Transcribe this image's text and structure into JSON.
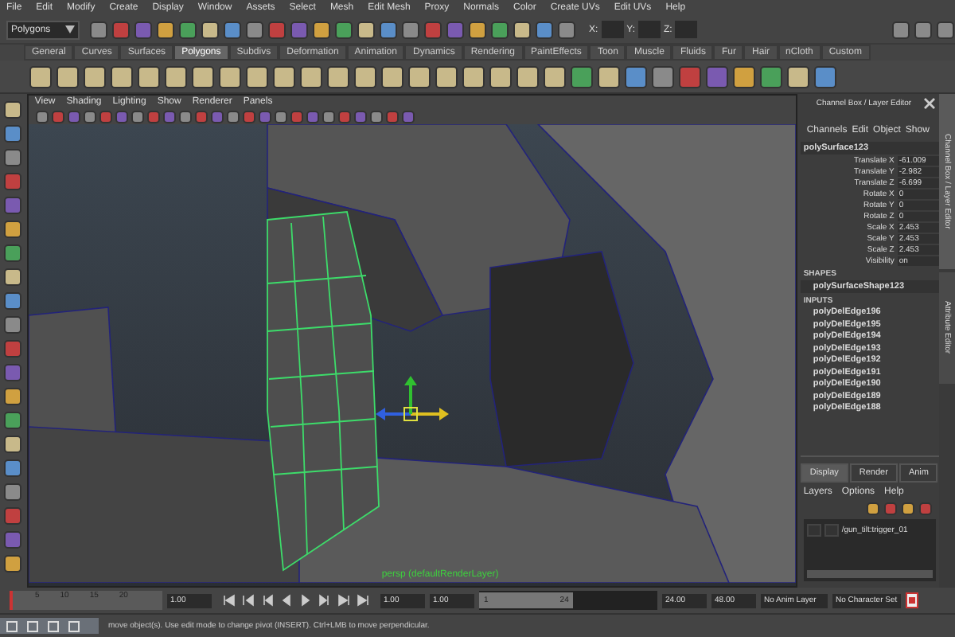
{
  "menu_bar": [
    "File",
    "Edit",
    "Modify",
    "Create",
    "Display",
    "Window",
    "Assets",
    "Select",
    "Mesh",
    "Edit Mesh",
    "Proxy",
    "Normals",
    "Color",
    "Create UVs",
    "Edit UVs",
    "Help"
  ],
  "status_line": {
    "mode": "Polygons",
    "x_label": "X:",
    "y_label": "Y:",
    "z_label": "Z:"
  },
  "shelf_tabs": [
    {
      "label": "General",
      "selected": false
    },
    {
      "label": "Curves",
      "selected": false
    },
    {
      "label": "Surfaces",
      "selected": false
    },
    {
      "label": "Polygons",
      "selected": true
    },
    {
      "label": "Subdivs",
      "selected": false
    },
    {
      "label": "Deformation",
      "selected": false
    },
    {
      "label": "Animation",
      "selected": false
    },
    {
      "label": "Dynamics",
      "selected": false
    },
    {
      "label": "Rendering",
      "selected": false
    },
    {
      "label": "PaintEffects",
      "selected": false
    },
    {
      "label": "Toon",
      "selected": false
    },
    {
      "label": "Muscle",
      "selected": false
    },
    {
      "label": "Fluids",
      "selected": false
    },
    {
      "label": "Fur",
      "selected": false
    },
    {
      "label": "Hair",
      "selected": false
    },
    {
      "label": "nCloth",
      "selected": false
    },
    {
      "label": "Custom",
      "selected": false
    }
  ],
  "viewport": {
    "menu": [
      "View",
      "Shading",
      "Lighting",
      "Show",
      "Renderer",
      "Panels"
    ],
    "camera_label": "persp (defaultRenderLayer)"
  },
  "channel_box": {
    "title": "Channel Box / Layer Editor",
    "menu": [
      "Channels",
      "Edit",
      "Object",
      "Show"
    ],
    "object": "polySurface123",
    "attributes": [
      {
        "name": "Translate X",
        "value": "-61.009"
      },
      {
        "name": "Translate Y",
        "value": "-2.982"
      },
      {
        "name": "Translate Z",
        "value": "-6.699"
      },
      {
        "name": "Rotate X",
        "value": "0"
      },
      {
        "name": "Rotate Y",
        "value": "0"
      },
      {
        "name": "Rotate Z",
        "value": "0"
      },
      {
        "name": "Scale X",
        "value": "2.453"
      },
      {
        "name": "Scale Y",
        "value": "2.453"
      },
      {
        "name": "Scale Z",
        "value": "2.453"
      },
      {
        "name": "Visibility",
        "value": "on"
      }
    ],
    "shapes_heading": "SHAPES",
    "shape": "polySurfaceShape123",
    "inputs_heading": "INPUTS",
    "inputs": [
      "polyDelEdge196",
      "polyDelEdge195",
      "polyDelEdge194",
      "polyDelEdge193",
      "polyDelEdge192",
      "polyDelEdge191",
      "polyDelEdge190",
      "polyDelEdge189",
      "polyDelEdge188"
    ]
  },
  "side_tabs": [
    "Channel Box / Layer Editor",
    "Attribute Editor"
  ],
  "layer_editor": {
    "tabs": [
      {
        "label": "Display",
        "selected": true
      },
      {
        "label": "Render",
        "selected": false
      },
      {
        "label": "Anim",
        "selected": false
      }
    ],
    "menu": [
      "Layers",
      "Options",
      "Help"
    ],
    "layers": [
      "/gun_tilt:trigger_01"
    ]
  },
  "time_slider": {
    "ticks": [
      "5",
      "10",
      "15",
      "20"
    ],
    "level": 0,
    "current_time": "1.00"
  },
  "range": {
    "level": 0.53,
    "start_time": "1.00",
    "playback_start": "1.00",
    "range_start": "1",
    "range_end": "24",
    "playback_end": "24.00",
    "end_time": "48.00",
    "anim_layer": "No Anim Layer",
    "character_set": "No Character Set"
  },
  "help_line": "move object(s). Use edit mode to change pivot (INSERT). Ctrl+LMB to move perpendicular."
}
